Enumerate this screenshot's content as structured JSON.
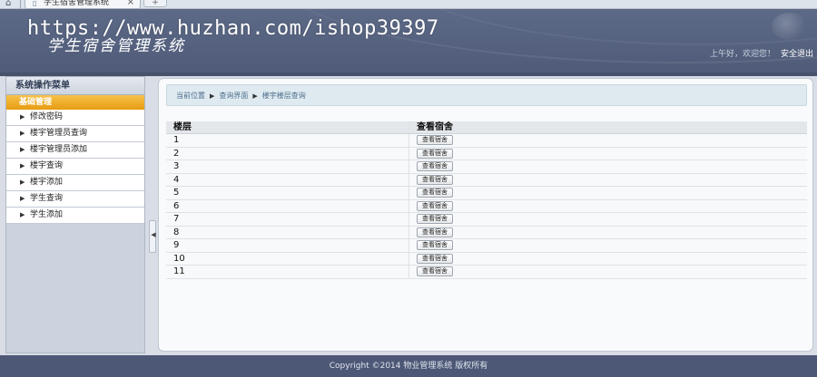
{
  "browser": {
    "tab_title": "学生宿舍管理系统",
    "close_glyph": "×",
    "newtab_glyph": "+",
    "home_glyph": "⌂",
    "doc_glyph": "▯"
  },
  "watermark": "https://www.huzhan.com/ishop39397",
  "header": {
    "system_title": "学生宿舍管理系统",
    "greeting": "上午好，欢迎您！",
    "logout_label": "安全退出"
  },
  "sidebar": {
    "title": "系统操作菜单",
    "group_label": "基础管理",
    "items": [
      {
        "label": "修改密码"
      },
      {
        "label": "楼宇管理员查询"
      },
      {
        "label": "楼宇管理员添加"
      },
      {
        "label": "楼宇查询"
      },
      {
        "label": "楼宇添加"
      },
      {
        "label": "学生查询"
      },
      {
        "label": "学生添加"
      }
    ]
  },
  "breadcrumb": {
    "items": [
      "当前位置",
      "查询界面",
      "楼宇楼层查询"
    ]
  },
  "table": {
    "headers": [
      "楼层",
      "查看宿舍"
    ],
    "button_label": "查看宿舍",
    "rows": [
      {
        "floor": "1"
      },
      {
        "floor": "2"
      },
      {
        "floor": "3"
      },
      {
        "floor": "4"
      },
      {
        "floor": "5"
      },
      {
        "floor": "6"
      },
      {
        "floor": "7"
      },
      {
        "floor": "8"
      },
      {
        "floor": "9"
      },
      {
        "floor": "10"
      },
      {
        "floor": "11"
      }
    ]
  },
  "footer": {
    "copyright": "Copyright ©2014 物业管理系统 版权所有"
  },
  "colors": {
    "header_bg": "#56627f",
    "menu_group_accent": "#f0ad2a",
    "footer_bg": "#4d5876"
  }
}
